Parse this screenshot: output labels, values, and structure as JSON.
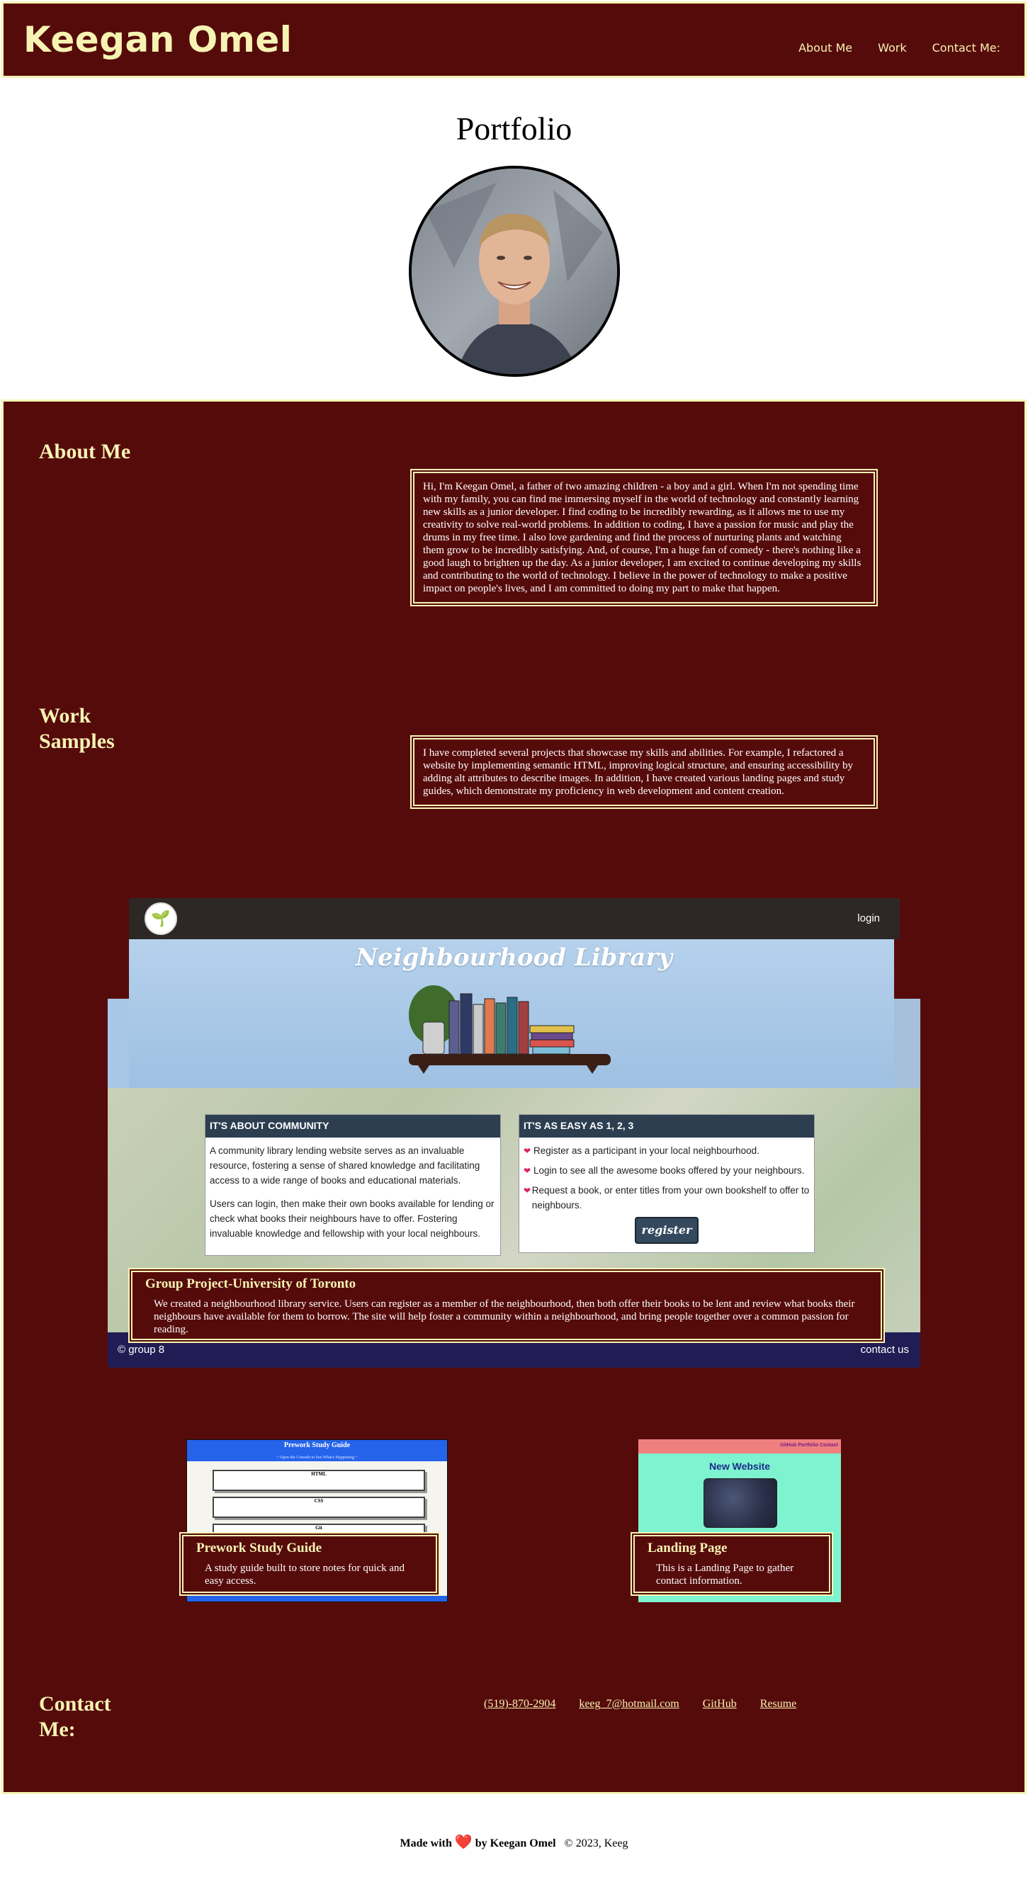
{
  "header": {
    "brand": "Keegan Omel",
    "nav": [
      "About Me",
      "Work",
      "Contact Me:"
    ]
  },
  "hero": {
    "title": "Portfolio"
  },
  "about": {
    "heading": "About Me",
    "text": "Hi, I'm Keegan Omel, a father of two amazing children - a boy and a girl. When I'm not spending time with my family, you can find me immersing myself in the world of technology and constantly learning new skills as a junior developer. I find coding to be incredibly rewarding, as it allows me to use my creativity to solve real-world problems. In addition to coding, I have a passion for music and play the drums in my free time. I also love gardening and find the process of nurturing plants and watching them grow to be incredibly satisfying. And, of course, I'm a huge fan of comedy - there's nothing like a good laugh to brighten up the day. As a junior developer, I am excited to continue developing my skills and contributing to the world of technology. I believe in the power of technology to make a positive impact on people's lives, and I am committed to doing my part to make that happen."
  },
  "work": {
    "heading": "Work Samples",
    "text": "I have completed several projects that showcase my skills and abilities. For example, I refactored a website by implementing semantic HTML, improving logical structure, and ensuring accessibility by adding alt attributes to describe images. In addition, I have created various landing pages and study guides, which demonstrate my proficiency in web development and content creation."
  },
  "library": {
    "login": "login",
    "title": "Neighbourhood Library",
    "card1": {
      "heading": "IT'S ABOUT COMMUNITY",
      "p1": "A community library lending website serves as an invaluable resource, fostering a sense of shared knowledge and facilitating access to a wide range of books and educational materials.",
      "p2": "Users can login, then make their own books available for lending or check what books their neighbours have to offer. Fostering invaluable knowledge and fellowship with your local neighbours."
    },
    "card2": {
      "heading": "IT'S AS EASY AS 1, 2, 3",
      "steps": [
        "Register as a participant in your local neighbourhood.",
        "Login to see all the awesome books offered by your neighbours.",
        "Request a book, or enter titles from your own bookshelf to offer to neighbours."
      ],
      "button": "register"
    },
    "footer_left": "© group 8",
    "footer_right": "contact us",
    "caption_title": "Group Project-University of Toronto",
    "caption_text": "We created a neighbourhood library service. Users can register as a member of the neighbourhood, then both offer their books to be lent and review what books their neighbours have available for them to borrow. The site will help foster a community within a neighbourhood, and bring people together over a common passion for reading."
  },
  "study": {
    "shot_title": "Prework Study Guide",
    "shot_sub": "~ Open the Console to See What's Happening ~",
    "rows": [
      "HTML",
      "CSS",
      "Git"
    ],
    "caption_title": "Prework Study Guide",
    "caption_text": "A study guide built to store notes for quick and easy access."
  },
  "landing": {
    "shot_links": "GitHub Portfolio Contact",
    "shot_heading": "New Website",
    "caption_title": "Landing Page",
    "caption_text": "This is a Landing Page to gather contact information."
  },
  "contact": {
    "heading": "Contact Me:",
    "links": [
      "(519)-870-2904",
      "keeg_7@hotmail.com",
      "GitHub",
      "Resume"
    ]
  },
  "footer": {
    "made_prefix": "Made with",
    "made_suffix": "by Keegan Omel",
    "copyright": "© 2023, Keeg"
  },
  "colors": {
    "maroon": "#560b0b",
    "cream": "#f6f3b3",
    "navy_footer": "#221c54"
  }
}
